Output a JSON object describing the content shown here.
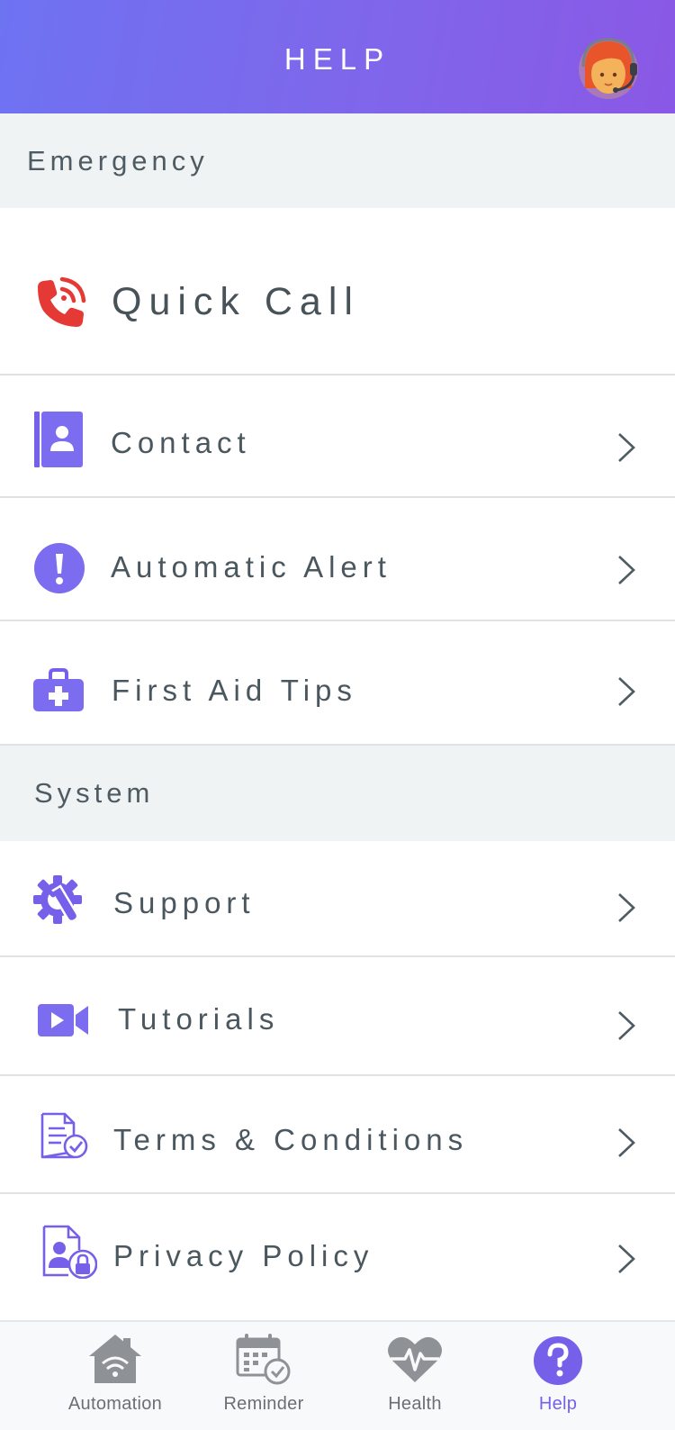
{
  "header": {
    "title": "HELP",
    "agent_icon": "support-agent-icon"
  },
  "sections": {
    "emergency": "Emergency",
    "system": "System"
  },
  "emergency_items": {
    "quick_call": {
      "label": "Quick Call",
      "icon": "phone-call-icon"
    },
    "contact": {
      "label": "Contact",
      "icon": "contact-book-icon"
    },
    "automatic_alert": {
      "label": "Automatic Alert",
      "icon": "alert-icon"
    },
    "first_aid": {
      "label": "First Aid Tips",
      "icon": "first-aid-kit-icon"
    }
  },
  "system_items": {
    "support": {
      "label": "Support",
      "icon": "gear-wrench-icon"
    },
    "tutorials": {
      "label": "Tutorials",
      "icon": "video-camera-icon"
    },
    "terms": {
      "label": "Terms & Conditions",
      "icon": "document-check-icon"
    },
    "privacy": {
      "label": "Privacy Policy",
      "icon": "document-lock-icon"
    }
  },
  "bottom_nav": {
    "automation": "Automation",
    "reminder": "Reminder",
    "health": "Health",
    "help": "Help",
    "active": "help"
  },
  "colors": {
    "accent": "#7660ea",
    "header_start": "#6e73f2",
    "header_end": "#8a58e6",
    "quick_call_red": "#e53935",
    "section_bg": "#f0f3f4",
    "text": "#4a575e"
  }
}
